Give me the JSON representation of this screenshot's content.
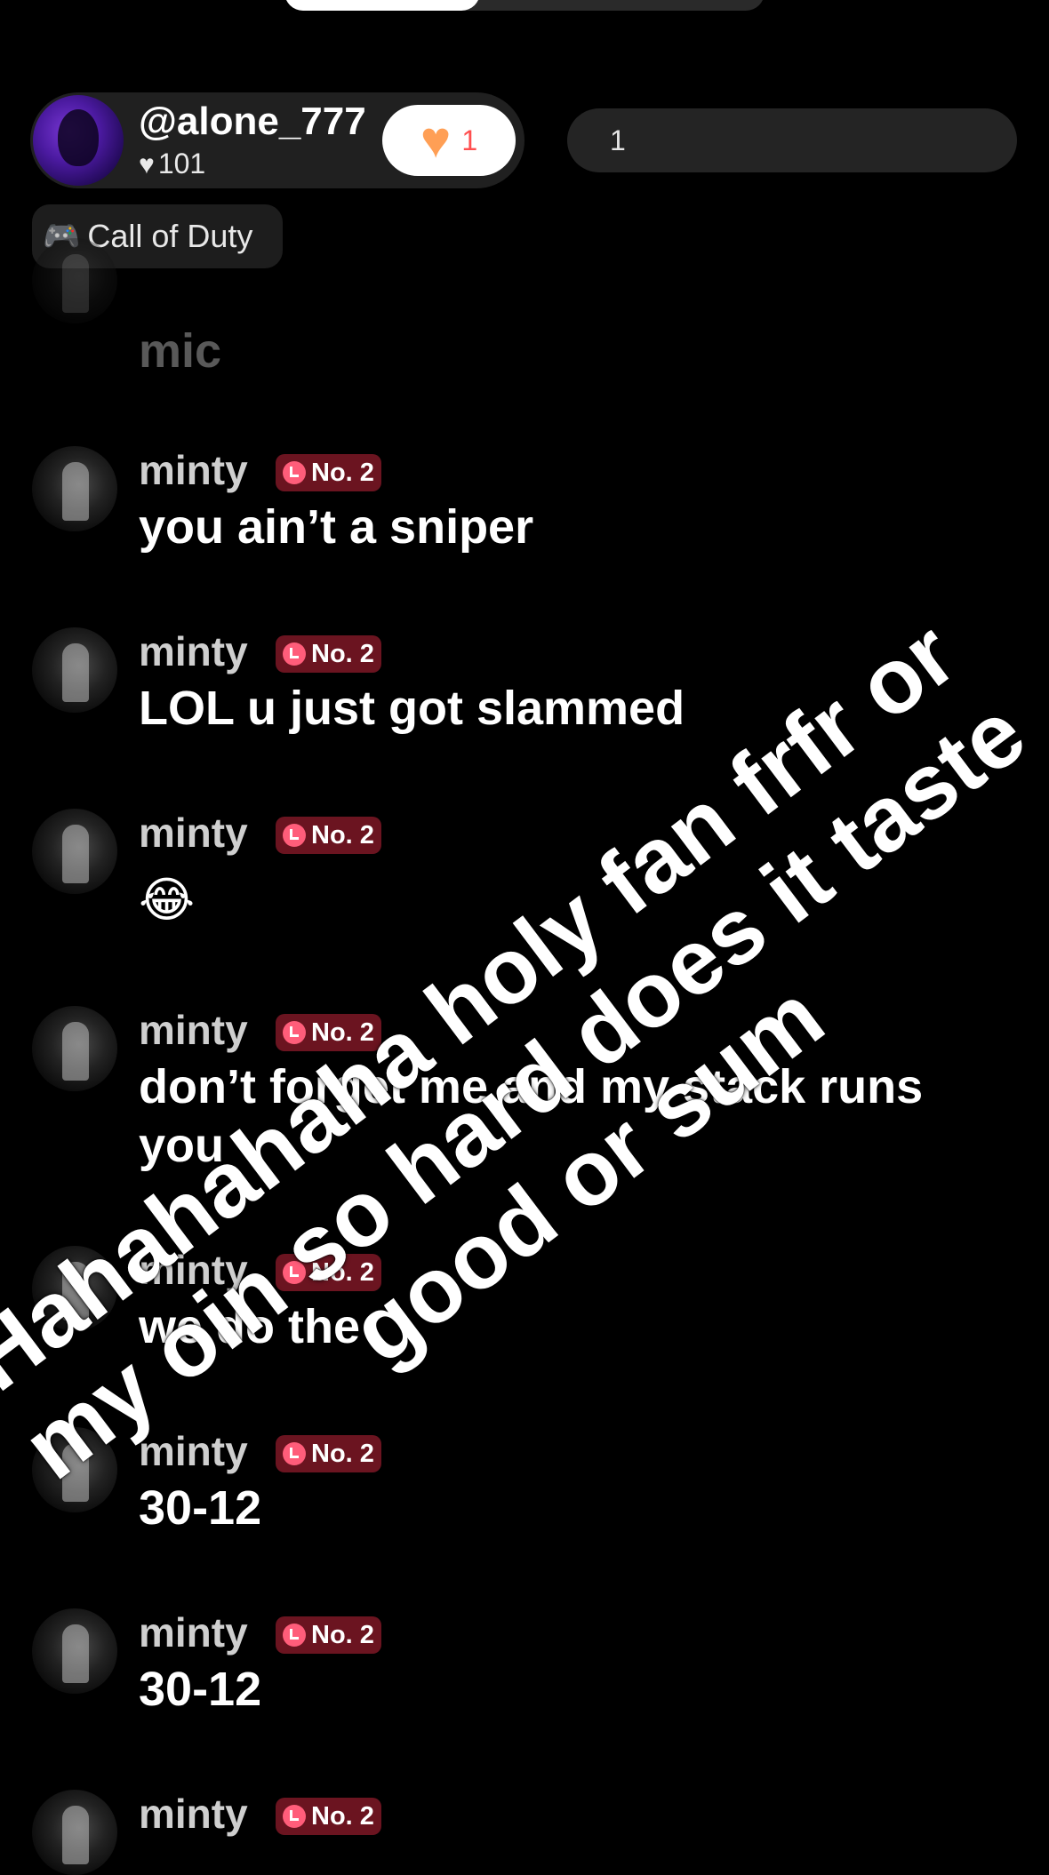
{
  "host": {
    "username": "@alone_777",
    "likes": "101",
    "like_count": "1",
    "viewer_count": "1",
    "game_tag": "Call of Duty"
  },
  "badge_label": "No. 2",
  "messages": [
    {
      "name": "",
      "text": "mic"
    },
    {
      "name": "minty",
      "text": "you ain’t a sniper"
    },
    {
      "name": "minty",
      "text": "LOL u just got slammed"
    },
    {
      "name": "minty",
      "text": "😂"
    },
    {
      "name": "minty",
      "text": "don’t forget me and my stack runs you"
    },
    {
      "name": "minty",
      "text": "we do the"
    },
    {
      "name": "minty",
      "text": "30-12"
    },
    {
      "name": "minty",
      "text": "30-12"
    },
    {
      "name": "minty",
      "text": ""
    }
  ],
  "overlay_text": "Hahahahaha holy fan frfr or my oin so hard does it taste good or sum",
  "icons": {
    "heart": "heart-icon",
    "game": "gamepad-icon",
    "badge": "alarm-clock-icon"
  },
  "colors": {
    "background": "#000000",
    "badge": "#6b1420",
    "like_heart": "#ff9f55",
    "like_count": "#ff4f4f"
  }
}
